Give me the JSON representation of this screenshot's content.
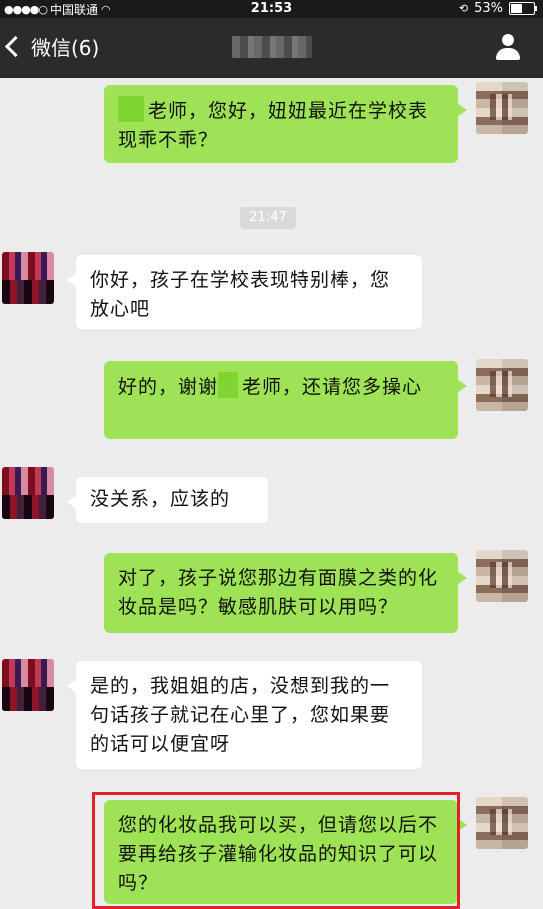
{
  "status_bar": {
    "signal_dots": "●●●●○",
    "carrier": "中国联通",
    "wifi_icon": "wifi-icon",
    "time": "21:53",
    "lock_icon": "rotation-lock-icon",
    "battery_percent": "53%",
    "battery_level": 0.53
  },
  "nav_bar": {
    "back_label": "微信(6)",
    "title_redacted": true,
    "profile_icon": "person-icon"
  },
  "chat": {
    "timestamp": "21:47",
    "messages": [
      {
        "side": "self",
        "text": "老师，您好，妞妞最近在学校表现乖不乖？",
        "lead_redacted": true
      },
      {
        "side": "other",
        "text": "你好，孩子在学校表现特别棒，您放心吧"
      },
      {
        "side": "self",
        "text_before": "好的，谢谢",
        "text_after": "老师，还请您多操心"
      },
      {
        "side": "other",
        "text": "没关系，应该的"
      },
      {
        "side": "self",
        "text": "对了，孩子说您那边有面膜之类的化妆品是吗？敏感肌肤可以用吗？"
      },
      {
        "side": "other",
        "text": "是的，我姐姐的店，没想到我的一句话孩子就记在心里了，您如果要的话可以便宜呀"
      },
      {
        "side": "self",
        "text": "您的化妆品我可以买，但请您以后不要再给孩子灌输化妆品的知识了可以吗？",
        "highlighted": true
      }
    ]
  },
  "colors": {
    "self_bubble": "#9ee356",
    "other_bubble": "#ffffff",
    "highlight": "#e0212b",
    "nav_bg": "#2b2b2b"
  }
}
